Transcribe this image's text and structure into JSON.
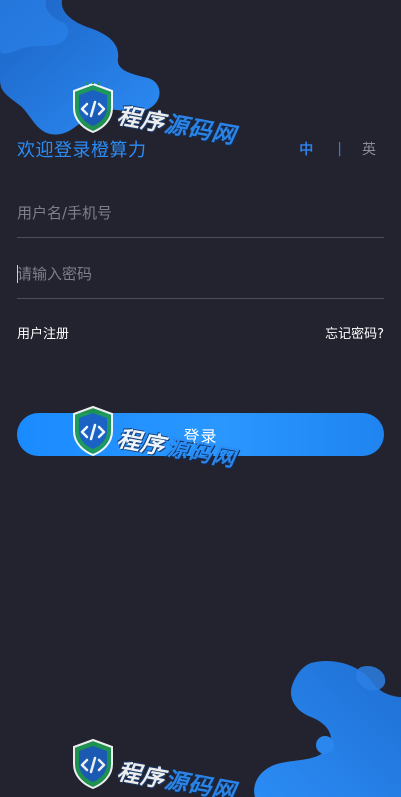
{
  "header": {
    "welcome": "欢迎登录橙算力",
    "lang_zh": "中",
    "lang_separator": "|",
    "lang_en": "英"
  },
  "form": {
    "username_placeholder": "用户名/手机号",
    "username_value": "",
    "password_placeholder": "请输入密码",
    "password_value": ""
  },
  "links": {
    "register": "用户注册",
    "forgot": "忘记密码?"
  },
  "login_button": {
    "label": "登录"
  },
  "watermark": {
    "part1": "程序",
    "part2": "源码网"
  },
  "colors": {
    "background": "#23232f",
    "accent": "#2b8cf5",
    "button_start": "#1a8bff",
    "button_end": "#1f84f0",
    "blob": "#1c6fd6",
    "input_line": "#4b4d5b",
    "placeholder": "#7d7f8a"
  },
  "icons": {
    "watermark_logo": "shield-code-icon"
  }
}
